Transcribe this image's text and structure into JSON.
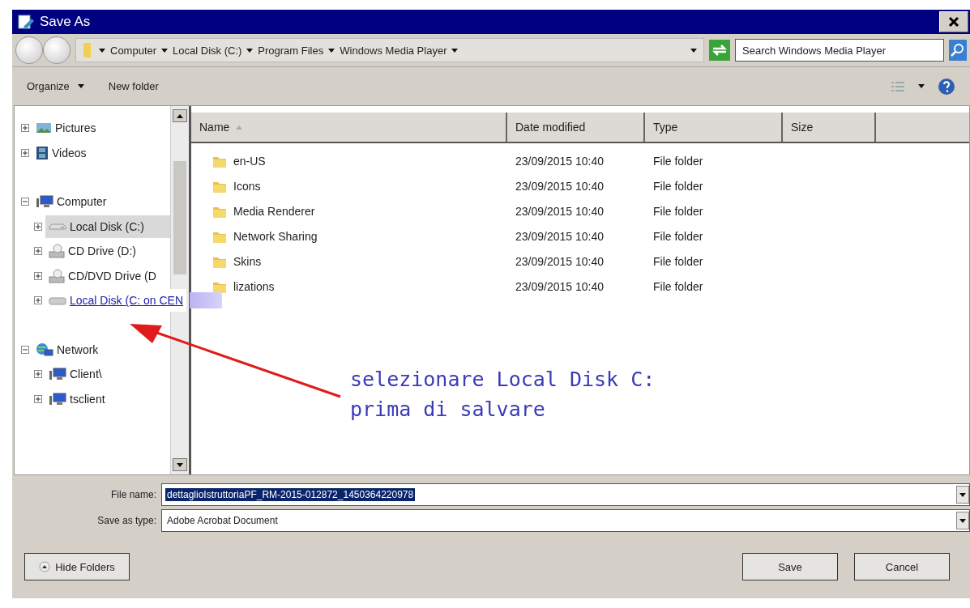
{
  "window": {
    "title": "Save As"
  },
  "address_bar": {
    "crumbs": [
      "Computer",
      "Local Disk (C:)",
      "Program Files",
      "Windows Media Player"
    ]
  },
  "search": {
    "placeholder": "Search Windows Media Player"
  },
  "toolbar": {
    "items": [
      {
        "label": "Organize",
        "kind": "menu"
      },
      {
        "label": "New folder",
        "kind": "button"
      }
    ]
  },
  "tree": [
    {
      "label": "Pictures",
      "kind": "pictures",
      "expanded": false,
      "selected": false
    },
    {
      "label": "Videos",
      "kind": "videos",
      "expanded": false,
      "selected": false
    },
    {
      "label": "Computer",
      "kind": "computer",
      "expanded": true,
      "selected": false,
      "children": [
        {
          "label": "Local Disk (C:)",
          "kind": "disk",
          "expanded": false,
          "selected": true
        },
        {
          "label": "CD Drive (D:)",
          "kind": "cd",
          "expanded": false,
          "selected": false
        },
        {
          "label": "CD/DVD Drive (D",
          "kind": "cd",
          "expanded": false,
          "selected": false
        },
        {
          "label": "Local Disk (C: on CEN",
          "kind": "netdisk",
          "expanded": false,
          "selected": false,
          "link": true
        }
      ]
    },
    {
      "label": "Network",
      "kind": "network",
      "expanded": true,
      "selected": false,
      "children": [
        {
          "label": "Client\\",
          "kind": "computer",
          "expanded": false,
          "selected": false
        },
        {
          "label": "tsclient",
          "kind": "computer",
          "expanded": false,
          "selected": false
        }
      ]
    }
  ],
  "table": {
    "columns": [
      {
        "label": "Name",
        "sorted": true
      },
      {
        "label": "Date modified",
        "sorted": false
      },
      {
        "label": "Type",
        "sorted": false
      },
      {
        "label": "Size",
        "sorted": false
      }
    ],
    "rows": [
      {
        "name": "en-US",
        "date": "23/09/2015 10:40",
        "type": "File folder"
      },
      {
        "name": "Icons",
        "date": "23/09/2015 10:40",
        "type": "File folder"
      },
      {
        "name": "Media Renderer",
        "date": "23/09/2015 10:40",
        "type": "File folder"
      },
      {
        "name": "Network Sharing",
        "date": "23/09/2015 10:40",
        "type": "File folder"
      },
      {
        "name": "Skins",
        "date": "23/09/2015 10:40",
        "type": "File folder"
      },
      {
        "name": "lizations",
        "date": "23/09/2015 10:40",
        "type": "File folder"
      }
    ]
  },
  "annotation": {
    "lines": [
      "selezionare Local Disk C:",
      "prima di salvare"
    ]
  },
  "file_name": {
    "label": "File name:",
    "value": "dettaglioIstruttoriaPF_RM-2015-012872_1450364220978"
  },
  "save_as_type": {
    "label": "Save as type:",
    "value": "Adobe Acrobat Document"
  },
  "hide_folders": {
    "label": "Hide Folders"
  },
  "buttons": [
    "Save",
    "Cancel"
  ]
}
